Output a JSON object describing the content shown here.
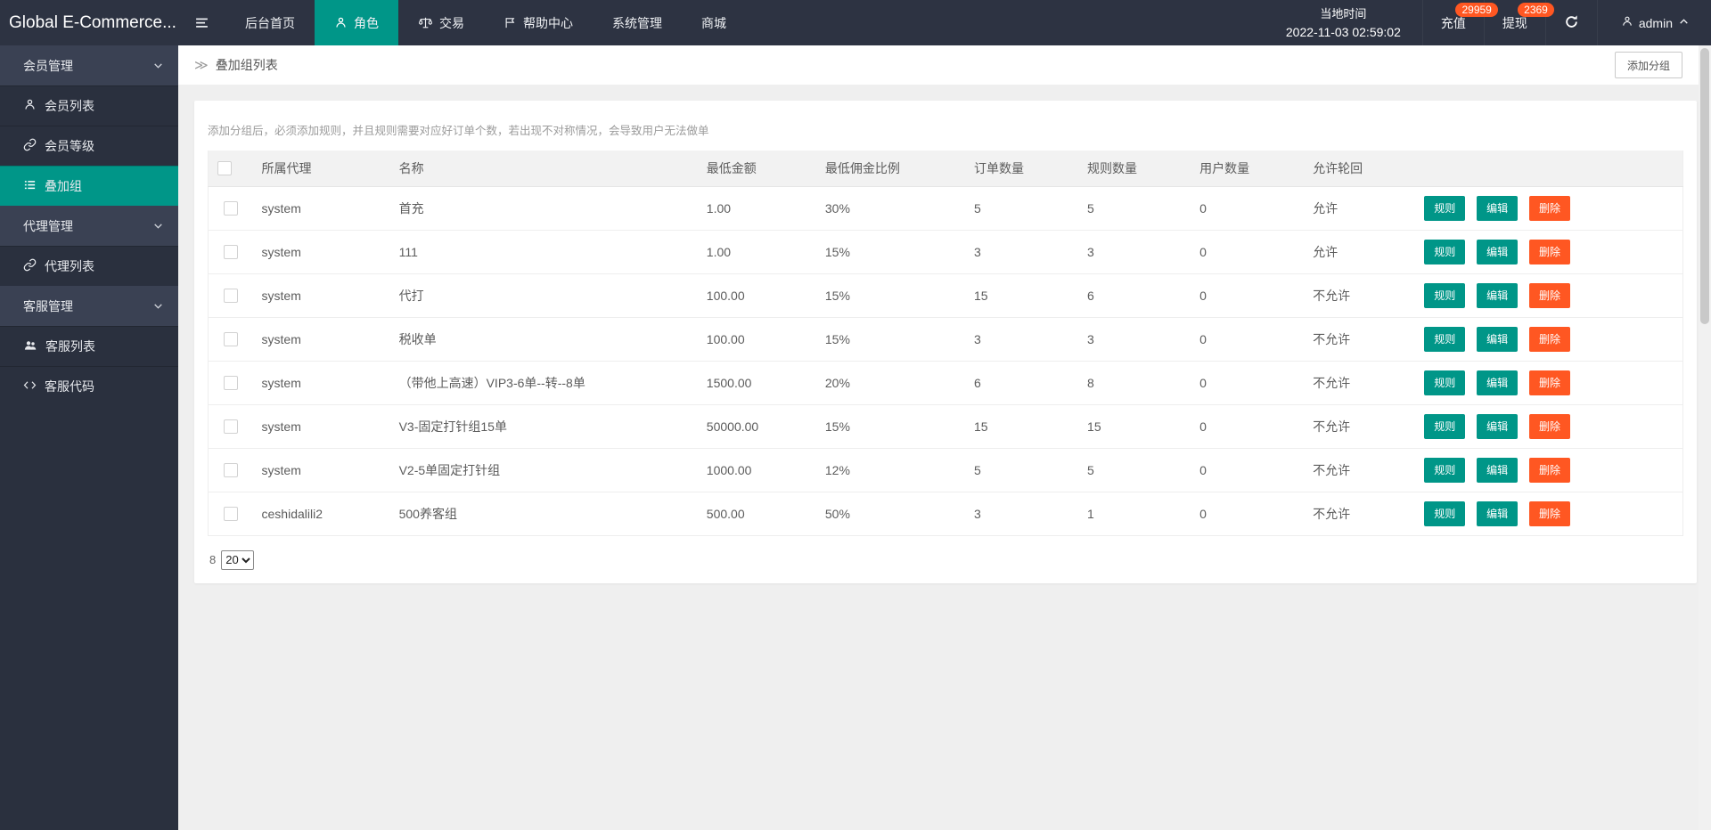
{
  "topbar": {
    "logo": "Global E-Commerce...",
    "nav": [
      {
        "label": "后台首页"
      },
      {
        "label": "角色"
      },
      {
        "label": "交易"
      },
      {
        "label": "帮助中心"
      },
      {
        "label": "系统管理"
      },
      {
        "label": "商城"
      }
    ],
    "time_label": "当地时间",
    "time_value": "2022-11-03 02:59:02",
    "recharge_label": "充值",
    "recharge_badge": "29959",
    "withdraw_label": "提现",
    "withdraw_badge": "2369",
    "username": "admin"
  },
  "sidebar": {
    "items": [
      {
        "type": "group",
        "label": "会员管理"
      },
      {
        "type": "item",
        "label": "会员列表",
        "icon": "user-icon"
      },
      {
        "type": "item",
        "label": "会员等级",
        "icon": "link-icon"
      },
      {
        "type": "item",
        "label": "叠加组",
        "icon": "list-icon",
        "active": true
      },
      {
        "type": "group",
        "label": "代理管理"
      },
      {
        "type": "item",
        "label": "代理列表",
        "icon": "link-icon"
      },
      {
        "type": "group",
        "label": "客服管理"
      },
      {
        "type": "item",
        "label": "客服列表",
        "icon": "users-icon"
      },
      {
        "type": "item",
        "label": "客服代码",
        "icon": "code-icon"
      }
    ]
  },
  "page": {
    "breadcrumb": "叠加组列表",
    "add_group_button": "添加分组",
    "notice": "添加分组后，必须添加规则，并且规则需要对应好订单个数，若出现不对称情况，会导致用户无法做单"
  },
  "table": {
    "headers": [
      "所属代理",
      "名称",
      "最低金额",
      "最低佣金比例",
      "订单数量",
      "规则数量",
      "用户数量",
      "允许轮回"
    ],
    "actions": [
      "规则",
      "编辑",
      "删除"
    ],
    "rows": [
      {
        "agent": "system",
        "name": "首充",
        "min_amount": "1.00",
        "min_commission": "30%",
        "orders": "5",
        "rules": "5",
        "users": "0",
        "loop": "允许"
      },
      {
        "agent": "system",
        "name": "111",
        "min_amount": "1.00",
        "min_commission": "15%",
        "orders": "3",
        "rules": "3",
        "users": "0",
        "loop": "允许"
      },
      {
        "agent": "system",
        "name": "代打",
        "min_amount": "100.00",
        "min_commission": "15%",
        "orders": "15",
        "rules": "6",
        "users": "0",
        "loop": "不允许"
      },
      {
        "agent": "system",
        "name": "税收单",
        "min_amount": "100.00",
        "min_commission": "15%",
        "orders": "3",
        "rules": "3",
        "users": "0",
        "loop": "不允许"
      },
      {
        "agent": "system",
        "name": "（带他上高速）VIP3-6单--转--8单",
        "min_amount": "1500.00",
        "min_commission": "20%",
        "orders": "6",
        "rules": "8",
        "users": "0",
        "loop": "不允许"
      },
      {
        "agent": "system",
        "name": "V3-固定打针组15单",
        "min_amount": "50000.00",
        "min_commission": "15%",
        "orders": "15",
        "rules": "15",
        "users": "0",
        "loop": "不允许"
      },
      {
        "agent": "system",
        "name": "V2-5单固定打针组",
        "min_amount": "1000.00",
        "min_commission": "12%",
        "orders": "5",
        "rules": "5",
        "users": "0",
        "loop": "不允许"
      },
      {
        "agent": "ceshidalili2",
        "name": "500养客组",
        "min_amount": "500.00",
        "min_commission": "50%",
        "orders": "3",
        "rules": "1",
        "users": "0",
        "loop": "不允许"
      }
    ]
  },
  "pagination": {
    "total": "8",
    "page_size": "20"
  },
  "colors": {
    "accent": "#009688",
    "danger": "#FF5722",
    "topbar_bg": "#2d3342",
    "sidebar_bg": "#2a303e",
    "sidebar_group_bg": "#3a4153"
  }
}
